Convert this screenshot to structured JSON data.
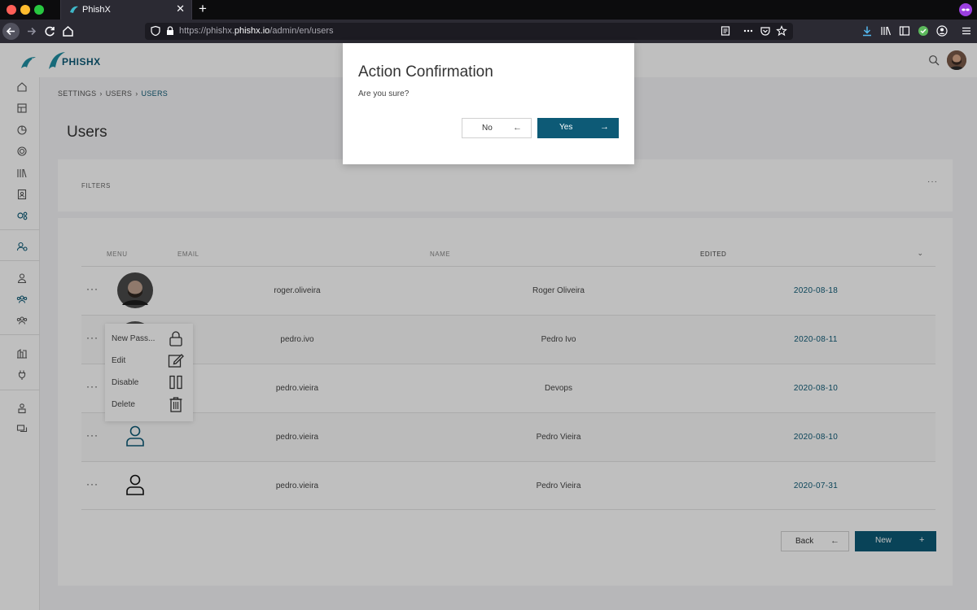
{
  "browser": {
    "tab_title": "PhishX",
    "tab_close": "✕",
    "new_tab": "+",
    "url_prefix": "https://phishx.",
    "url_domain": "phishx.io",
    "url_path": "/admin/en/users"
  },
  "header": {
    "logo_text": "PHISHX"
  },
  "breadcrumb": {
    "items": [
      "SETTINGS",
      "USERS",
      "USERS"
    ],
    "separator": "›"
  },
  "page": {
    "title": "Users"
  },
  "filters": {
    "label": "FILTERS",
    "more": "···"
  },
  "table": {
    "columns": [
      "MENU",
      "EMAIL",
      "NAME",
      "EDITED"
    ],
    "sort_indicator": "⌄",
    "row_menu": "···",
    "rows": [
      {
        "email": "roger.oliveira",
        "name": "Roger Oliveira",
        "edited": "2020-08-18",
        "avatar": "photo"
      },
      {
        "email": "pedro.ivo",
        "name": "Pedro Ivo",
        "edited": "2020-08-11",
        "avatar": "photo"
      },
      {
        "email": "pedro.vieira",
        "name": "Devops",
        "edited": "2020-08-10",
        "avatar": "none"
      },
      {
        "email": "pedro.vieira",
        "name": "Pedro Vieira",
        "edited": "2020-08-10",
        "avatar": "user-icon-teal"
      },
      {
        "email": "pedro.vieira",
        "name": "Pedro Vieira",
        "edited": "2020-07-31",
        "avatar": "user-icon-black"
      }
    ]
  },
  "context_menu": {
    "items": [
      {
        "label": "New Pass...",
        "icon": "lock-icon"
      },
      {
        "label": "Edit",
        "icon": "edit-icon"
      },
      {
        "label": "Disable",
        "icon": "pause-icon"
      },
      {
        "label": "Delete",
        "icon": "trash-icon"
      }
    ]
  },
  "footer_buttons": {
    "back_label": "Back",
    "back_icon": "←",
    "new_label": "New",
    "new_icon": "+"
  },
  "modal": {
    "title": "Action Confirmation",
    "message": "Are you sure?",
    "no_label": "No",
    "no_icon": "←",
    "yes_label": "Yes",
    "yes_icon": "→"
  },
  "colors": {
    "accent": "#0d5a76",
    "browser_bg": "#2b2a33",
    "overlay": "rgba(0,0,0,0.25)"
  }
}
